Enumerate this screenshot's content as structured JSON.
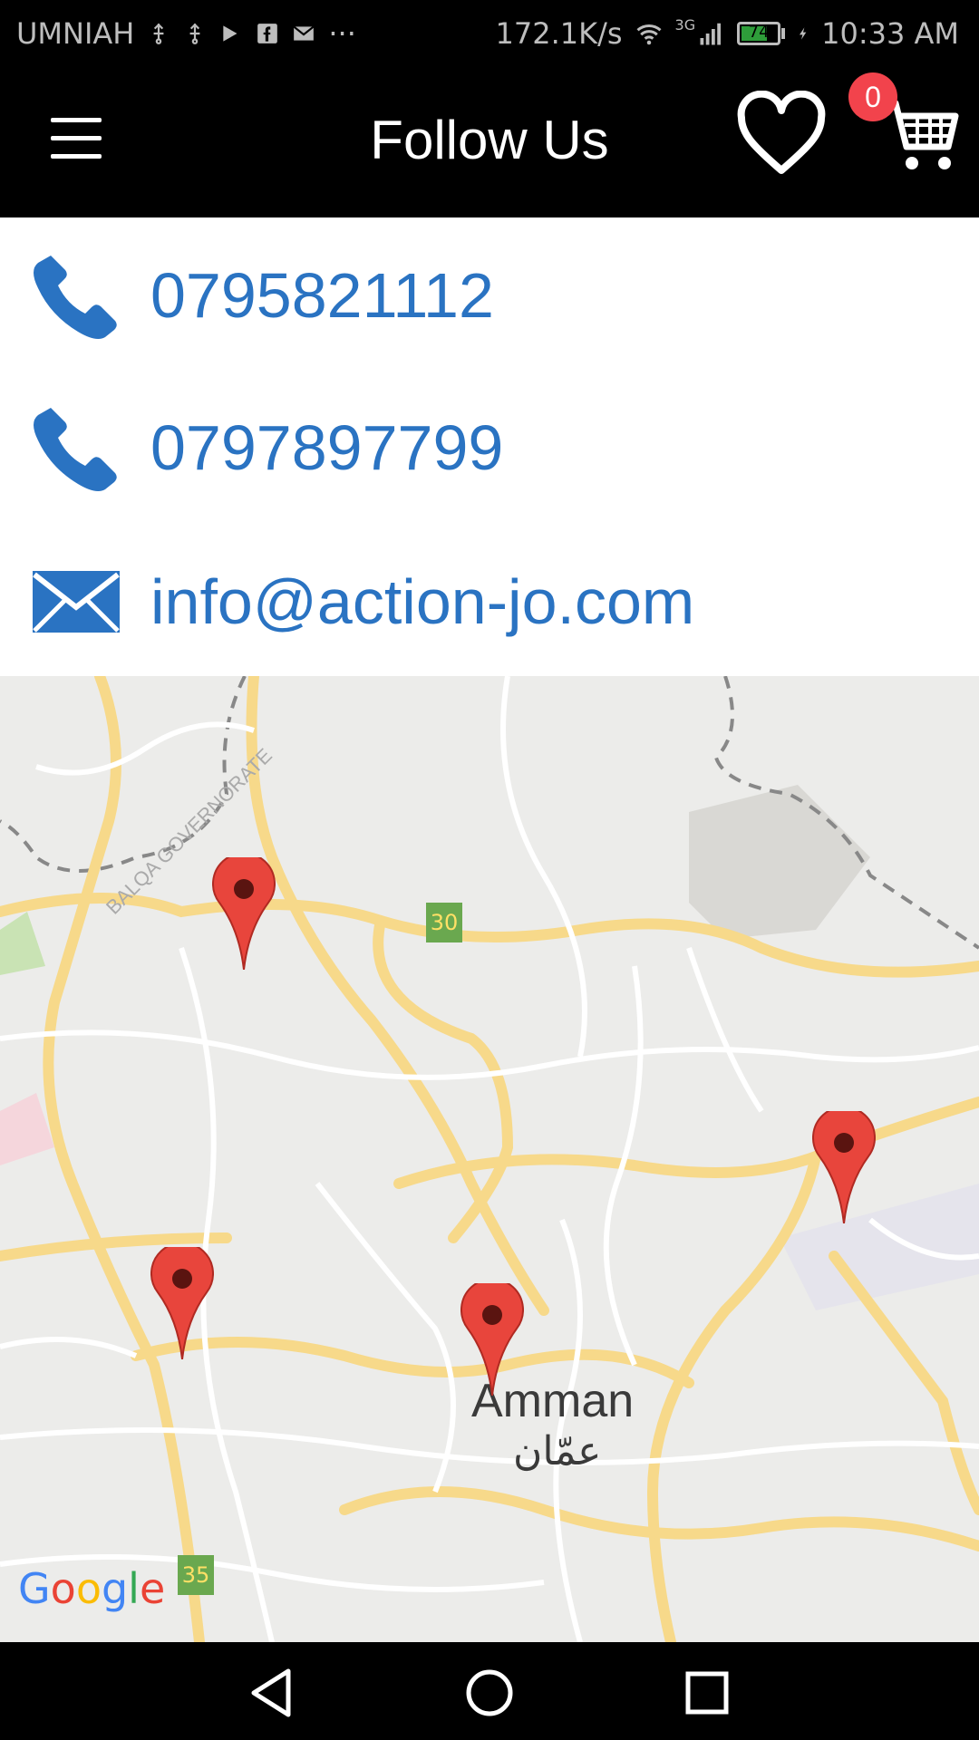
{
  "status_bar": {
    "carrier": "UMNIAH",
    "more": "···",
    "speed": "172.1K/s",
    "network": "3G",
    "battery": "74",
    "battery_level": 0.74,
    "time": "10:33 AM"
  },
  "app_bar": {
    "title": "Follow Us",
    "cart_count": "0"
  },
  "contacts": [
    {
      "type": "phone",
      "value": "0795821112"
    },
    {
      "type": "phone",
      "value": "0797897799"
    },
    {
      "type": "email",
      "value": "info@action-jo.com"
    }
  ],
  "map": {
    "city": "Amman",
    "city_ar": "عمّان",
    "governorate": "BALQA GOVERNORATE",
    "road_badges": [
      "30",
      "35"
    ],
    "attribution": "Google"
  },
  "colors": {
    "accent": "#2a73c2",
    "badge": "#f2434c",
    "pin": "#e8453c"
  }
}
